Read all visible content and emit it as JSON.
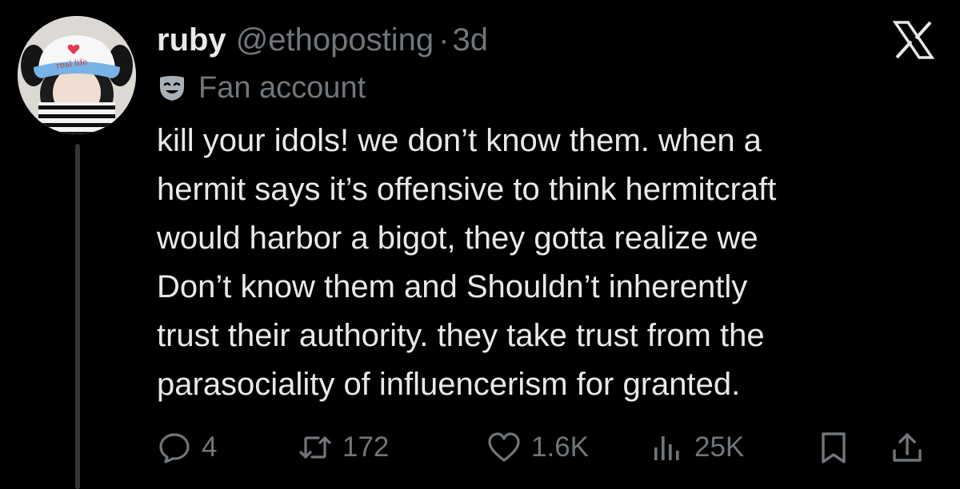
{
  "author": {
    "name": "ruby",
    "handle": "@ethoposting",
    "separator": "·",
    "time": "3d",
    "avatar_icon": "profile-photo",
    "avatar_cap_text": "real life"
  },
  "badge": {
    "icon": "mask-icon",
    "label": "Fan account"
  },
  "tweet": {
    "lines": [
      "kill your idols! we don’t know them. when a",
      "hermit says it’s offensive to think hermitcraft",
      "would harbor a bigot, they gotta realize we",
      "Don’t know them and Shouldn’t inherently",
      "trust their authority. they take trust from the",
      "parasociality of influencerism for granted."
    ]
  },
  "actions": {
    "replies": "4",
    "reposts": "172",
    "likes": "1.6K",
    "views": "25K",
    "bookmark_icon": "bookmark-icon",
    "share_icon": "share-icon"
  },
  "window": {
    "close_icon": "x-logo-icon"
  },
  "colors": {
    "background": "#000000",
    "primary_text": "#e7e9ea",
    "secondary_text": "#71767b",
    "thread_line": "#333639"
  }
}
